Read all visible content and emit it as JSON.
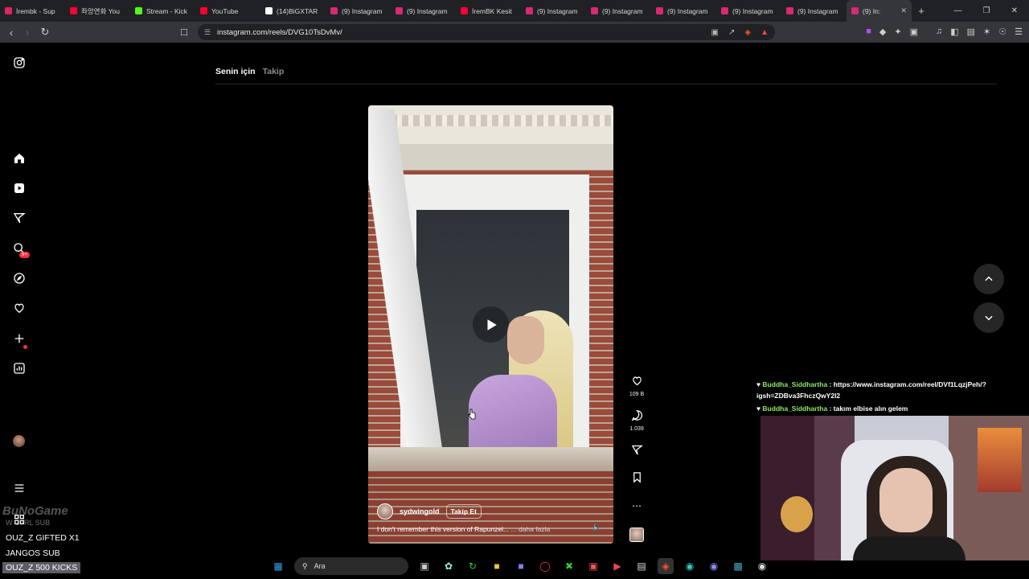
{
  "browser": {
    "tabs": [
      {
        "label": "İrembk - Sup",
        "color": "#e0245e"
      },
      {
        "label": "좌앙연화 You",
        "color": "#ff0033"
      },
      {
        "label": "Stream - Kick",
        "color": "#53fc18"
      },
      {
        "label": "YouTube",
        "color": "#ff0033"
      },
      {
        "label": "(14)BiGXTAR",
        "color": "#ffffff"
      },
      {
        "label": "(9) Instagram",
        "color": "#d62976"
      },
      {
        "label": "(9) Instagram",
        "color": "#d62976"
      },
      {
        "label": "İremBK Kesit",
        "color": "#ff0033"
      },
      {
        "label": "(9) Instagram",
        "color": "#d62976"
      },
      {
        "label": "(9) Instagram",
        "color": "#d62976"
      },
      {
        "label": "(9) Instagram",
        "color": "#d62976"
      },
      {
        "label": "(9) Instagram",
        "color": "#d62976"
      },
      {
        "label": "(9) Instagram",
        "color": "#d62976"
      },
      {
        "label": "(9) In:",
        "color": "#d62976",
        "active": true
      }
    ],
    "new_tab": "+",
    "url": "instagram.com/reels/DVG10TsDvMv/"
  },
  "instagram": {
    "sidebar_icons": [
      "instagram-logo-icon",
      "home-icon",
      "reels-icon",
      "messages-icon",
      "search-icon",
      "explore-icon",
      "notifications-icon",
      "create-icon",
      "dashboard-icon",
      "profile-avatar",
      "menu-icon",
      "more-apps-icon"
    ],
    "messages_badge": "9+",
    "feed_tabs": {
      "for_you": "Senin için",
      "following": "Takip"
    },
    "reel": {
      "username": "sydwingold",
      "follow_label": "Takip Et",
      "caption": "I don't remember this version of Rapunzel...",
      "more_label": "... daha fazla"
    },
    "actions": {
      "likes": "109 B",
      "comments": "1.039"
    }
  },
  "chat": [
    {
      "user": "Buddha_Siddhartha",
      "text": ": https://www.instagram.com/reel/DVf1LqzjPeh/?igsh=ZDBva3FhczQwY2l2"
    },
    {
      "user": "Buddha_Siddhartha",
      "text": ": takım elbise alın gelem"
    }
  ],
  "stream_overlay": {
    "brand": "BuNoGame",
    "dim_line": "W CTRL SUB",
    "line1": "OUZ_Z  GIFTED X1",
    "line2": "JANGOS  SUB",
    "highlight": "OUZ_Z  500 KICKS"
  },
  "taskbar": {
    "search_placeholder": "Ara"
  }
}
